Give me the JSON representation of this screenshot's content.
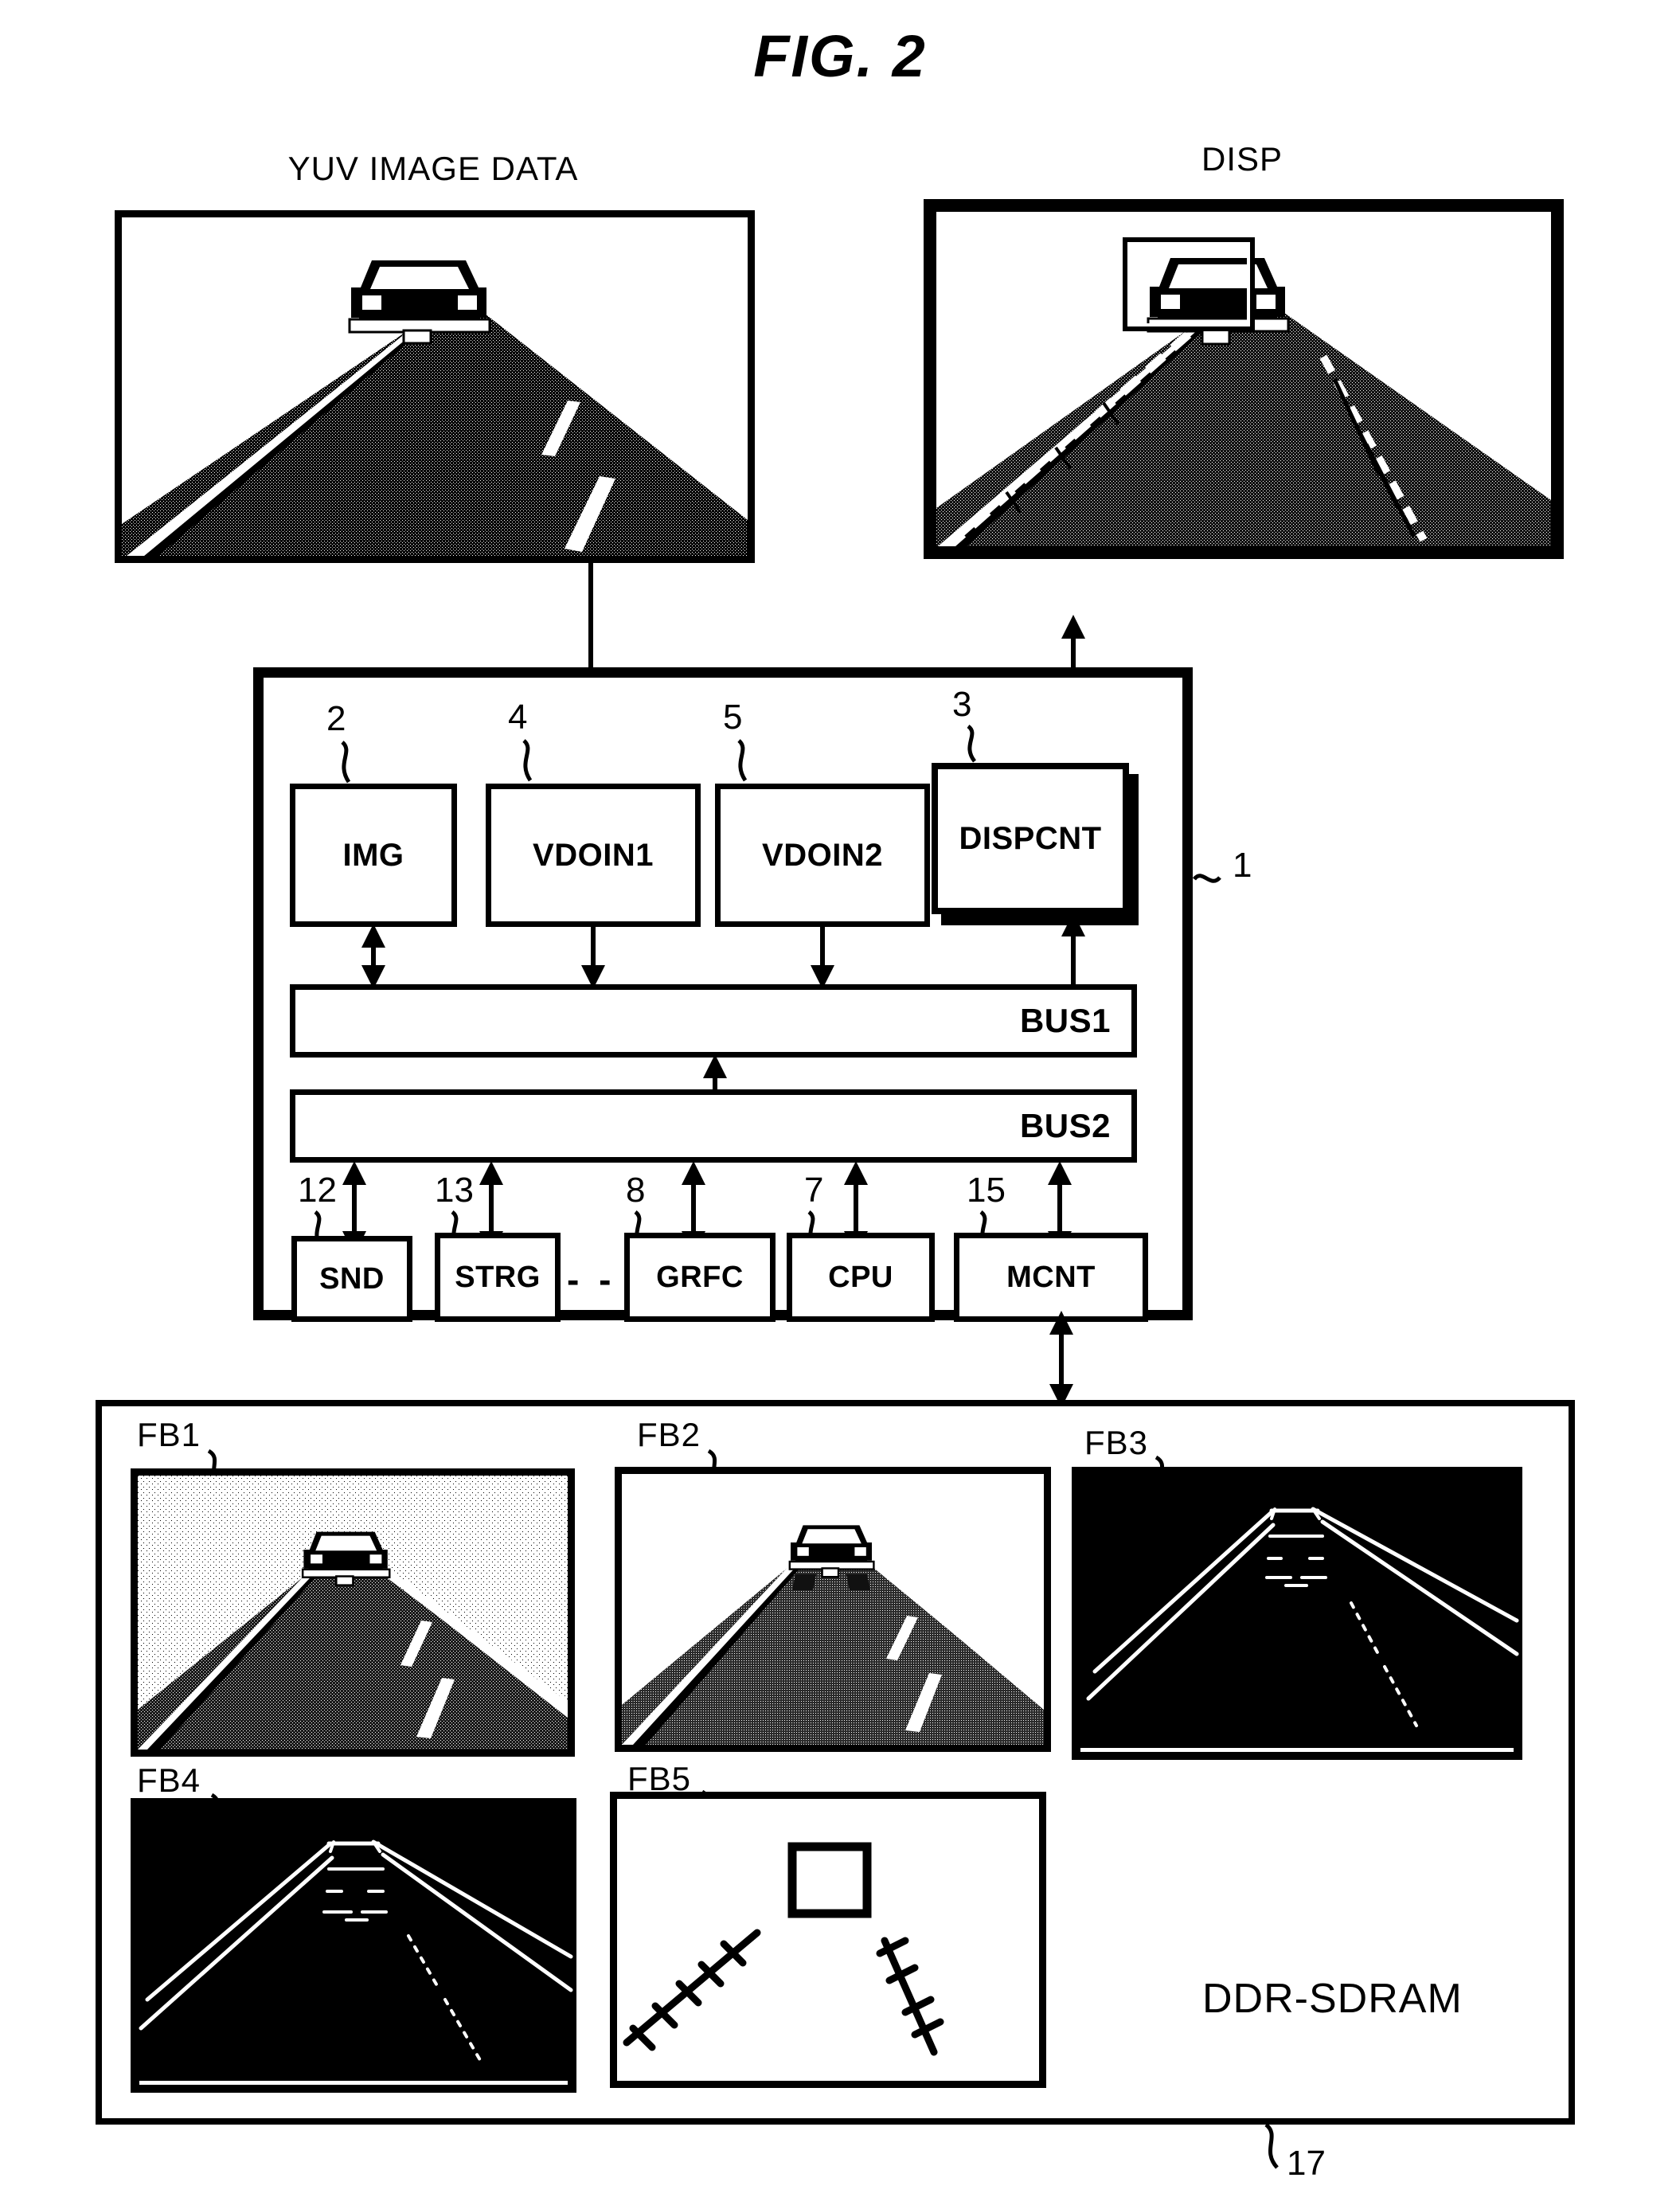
{
  "figure": {
    "title": "FIG.  2"
  },
  "top_panels": [
    {
      "caption": "YUV IMAGE DATA",
      "name": "yuv-image-panel"
    },
    {
      "caption": "DISP",
      "name": "disp-panel"
    }
  ],
  "chip": {
    "ref": "1",
    "units": [
      {
        "label": "IMG",
        "ref": "2"
      },
      {
        "label": "VDOIN1",
        "ref": "4"
      },
      {
        "label": "VDOIN2",
        "ref": "5"
      },
      {
        "label": "DISPCNT",
        "ref": "3"
      }
    ],
    "buses": [
      {
        "label": "BUS1"
      },
      {
        "label": "BUS2"
      }
    ],
    "peripherals": [
      {
        "label": "SND",
        "ref": "12"
      },
      {
        "label": "STRG",
        "ref": "13"
      },
      {
        "label": "GRFC",
        "ref": "8"
      },
      {
        "label": "CPU",
        "ref": "7"
      },
      {
        "label": "MCNT",
        "ref": "15"
      }
    ],
    "ellipsis": "- - -"
  },
  "memory": {
    "ref": "17",
    "label": "DDR-SDRAM",
    "framebuffers": [
      {
        "label": "FB1"
      },
      {
        "label": "FB2"
      },
      {
        "label": "FB3"
      },
      {
        "label": "FB4"
      },
      {
        "label": "FB5"
      }
    ]
  },
  "colors": {
    "ink": "#000000",
    "paper": "#ffffff"
  }
}
